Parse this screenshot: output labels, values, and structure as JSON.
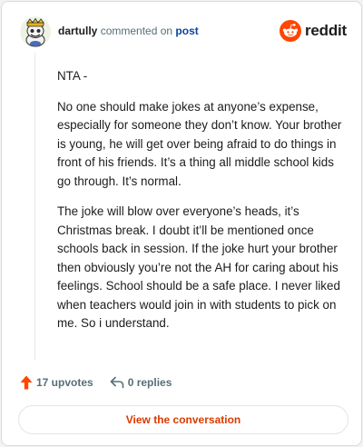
{
  "header": {
    "username": "dartully",
    "action_text": "commented on",
    "post_link": "post",
    "brand_wordmark": "reddit"
  },
  "comment": {
    "paragraphs": [
      "NTA -",
      "No one should make jokes at anyone’s expense, especially for someone they don’t know. Your brother is young, he will get over being afraid to do things in front of his friends. It’s a thing all middle school kids go through. It’s normal.",
      "The joke will blow over everyone’s heads, it’s Christmas break. I doubt it’ll be mentioned once schools back in session. If the joke hurt your brother then obviously you’re not the AH for caring about his feelings. School should be a safe place. I never liked when teachers would join in with students to pick on me. So i understand."
    ]
  },
  "actions": {
    "upvotes": "17 upvotes",
    "replies": "0 replies"
  },
  "cta": {
    "label": "View the conversation"
  },
  "icons": {
    "avatar": "snoo-avatar-icon",
    "brand": "reddit-logo-icon",
    "upvote": "upvote-arrow-icon",
    "reply": "reply-arrow-icon"
  },
  "colors": {
    "brand_orange": "#ff4500",
    "upvote_orange": "#ff4500",
    "link_blue": "#0a449b",
    "cta_text": "#d93a00",
    "muted_text": "#576f76"
  }
}
